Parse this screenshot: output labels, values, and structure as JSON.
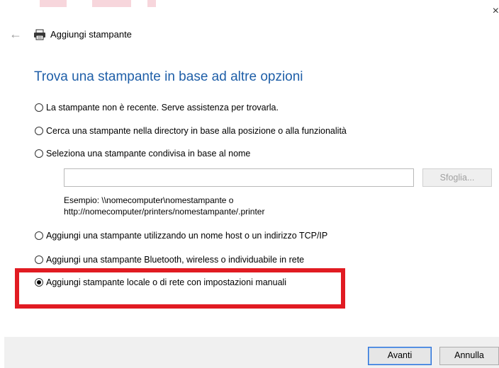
{
  "window": {
    "title": "Aggiungi stampante",
    "close_glyph": "×",
    "back_glyph": "←",
    "icons": {
      "back": "back-arrow-icon",
      "printer": "printer-icon",
      "close": "close-icon"
    }
  },
  "heading": "Trova una stampante in base ad altre opzioni",
  "options": [
    {
      "label": "La stampante non è recente. Serve assistenza per trovarla.",
      "selected": false
    },
    {
      "label": "Cerca una stampante nella directory in base alla posizione o alla funzionalità",
      "selected": false
    },
    {
      "label": "Seleziona una stampante condivisa in base al nome",
      "selected": false
    },
    {
      "label": "Aggiungi una stampante utilizzando un nome host o un indirizzo TCP/IP",
      "selected": false
    },
    {
      "label": "Aggiungi una stampante Bluetooth, wireless o individuabile in rete",
      "selected": false
    },
    {
      "label": "Aggiungi stampante locale o di rete con impostazioni manuali",
      "selected": true
    }
  ],
  "shared_printer": {
    "input_value": "",
    "browse_label": "Sfoglia...",
    "example_line1": "Esempio: \\\\nomecomputer\\nomestampante o",
    "example_line2": "http://nomecomputer/printers/nomestampante/.printer"
  },
  "footer": {
    "next_label": "Avanti",
    "cancel_label": "Annulla"
  },
  "colors": {
    "heading": "#1f5fa8",
    "highlight_border": "#e11b22",
    "footer_bg": "#f0f0f0",
    "default_button_border": "#2b6fd6"
  }
}
